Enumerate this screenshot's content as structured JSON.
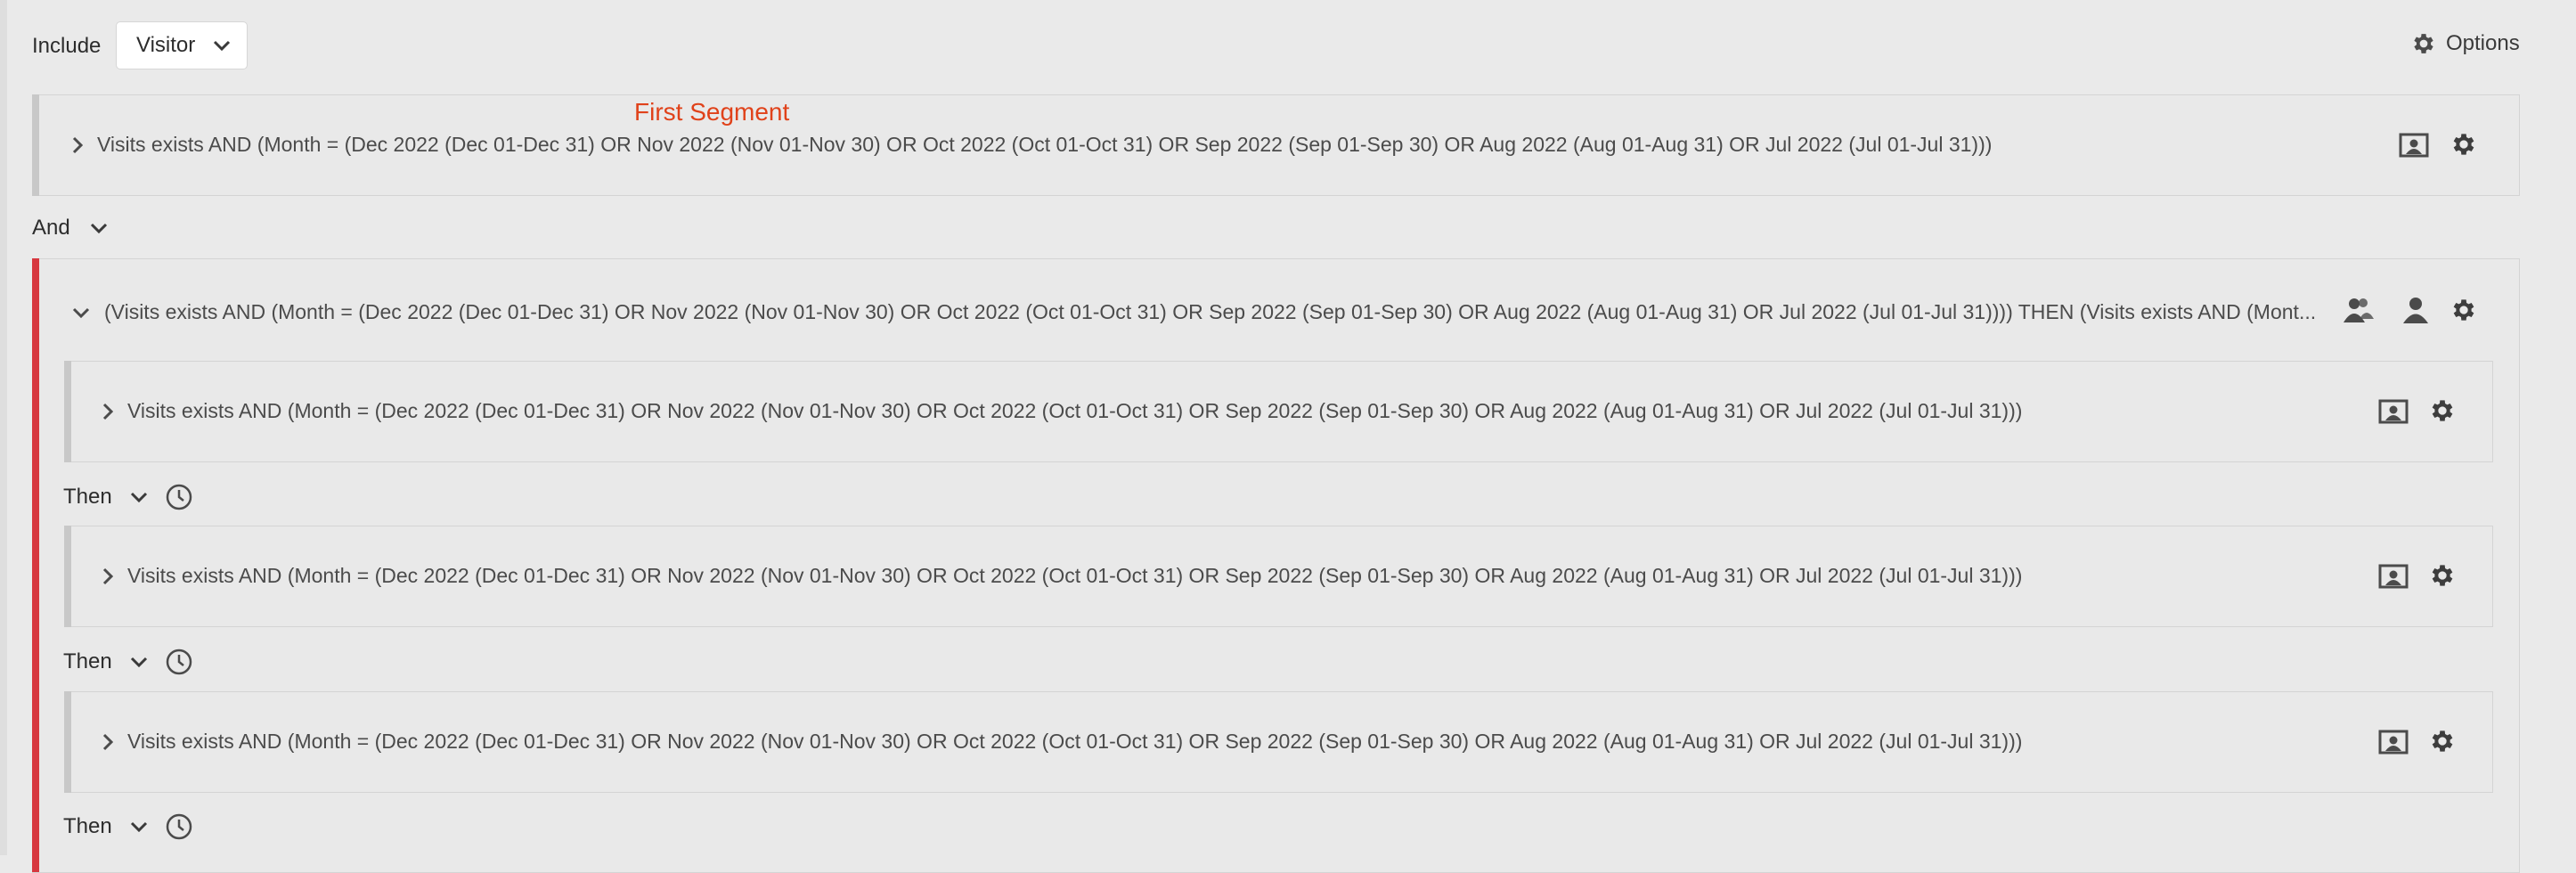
{
  "header": {
    "include_label": "Include",
    "visitor_select": "Visitor",
    "options_label": "Options"
  },
  "annotation": "First Segment",
  "first_segment": {
    "text": "Visits exists AND (Month = (Dec 2022 (Dec 01-Dec 31) OR Nov 2022 (Nov 01-Nov 30) OR Oct 2022 (Oct 01-Oct 31) OR Sep 2022 (Sep 01-Sep 30) OR Aug 2022 (Aug 01-Aug 31) OR Jul 2022 (Jul 01-Jul 31)))"
  },
  "operator": {
    "and_label": "And"
  },
  "sequential": {
    "text": "(Visits exists AND (Month = (Dec 2022 (Dec 01-Dec 31) OR Nov 2022 (Nov 01-Nov 30) OR Oct 2022 (Oct 01-Oct 31) OR Sep 2022 (Sep 01-Sep 30) OR Aug 2022 (Aug 01-Aug 31) OR Jul 2022 (Jul 01-Jul 31)))) THEN (Visits exists AND (Mont...",
    "rows": [
      {
        "text": "Visits exists AND (Month = (Dec 2022 (Dec 01-Dec 31) OR Nov 2022 (Nov 01-Nov 30) OR Oct 2022 (Oct 01-Oct 31) OR Sep 2022 (Sep 01-Sep 30) OR Aug 2022 (Aug 01-Aug 31) OR Jul 2022 (Jul 01-Jul 31)))"
      },
      {
        "text": "Visits exists AND (Month = (Dec 2022 (Dec 01-Dec 31) OR Nov 2022 (Nov 01-Nov 30) OR Oct 2022 (Oct 01-Oct 31) OR Sep 2022 (Sep 01-Sep 30) OR Aug 2022 (Aug 01-Aug 31) OR Jul 2022 (Jul 01-Jul 31)))"
      },
      {
        "text": "Visits exists AND (Month = (Dec 2022 (Dec 01-Dec 31) OR Nov 2022 (Nov 01-Nov 30) OR Oct 2022 (Oct 01-Oct 31) OR Sep 2022 (Sep 01-Sep 30) OR Aug 2022 (Aug 01-Aug 31) OR Jul 2022 (Jul 01-Jul 31)))"
      }
    ],
    "then_labels": [
      "Then",
      "Then",
      "Then"
    ]
  },
  "icons": {
    "chevron": "chevron-icon",
    "gear": "gear-icon",
    "visitor_card": "visitor-container-icon",
    "visitor_group": "people-icon",
    "person": "person-icon",
    "clock": "clock-icon"
  }
}
